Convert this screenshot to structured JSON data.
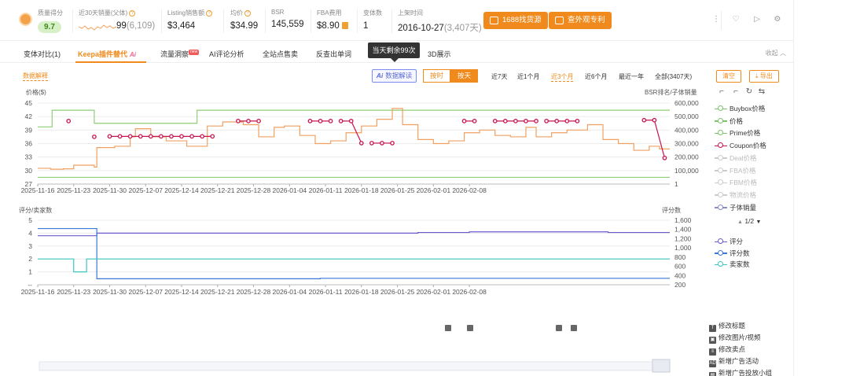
{
  "header": {
    "quality": {
      "label": "质量得分",
      "value": "9.7"
    },
    "sales30": {
      "label": "近30天销量(父体)",
      "value": "99",
      "paren": "(6,109)"
    },
    "listing_sales": {
      "label": "Listing销售额",
      "value": "$3,464"
    },
    "avg_price": {
      "label": "均价",
      "value": "$34.99"
    },
    "bsr": {
      "label": "BSR",
      "value": "145,559"
    },
    "fba": {
      "label": "FBA费用",
      "value": "$8.90"
    },
    "variants": {
      "label": "变体数",
      "value": "1"
    },
    "launch": {
      "label": "上架时间",
      "value": "2016-10-27",
      "paren": "(3,407天)"
    },
    "btn_source": "1688找货源",
    "btn_patent": "查外观专利"
  },
  "tooltip": "当天剩余99次",
  "tabs": [
    {
      "label": "变体对比(1)"
    },
    {
      "label": "Keepa插件替代",
      "ai": "Ai"
    },
    {
      "label": "流量洞察",
      "badge": "new"
    },
    {
      "label": "AI评论分析"
    },
    {
      "label": "全站点售卖"
    },
    {
      "label": "反查出单词"
    },
    {
      "label": "3D展示"
    }
  ],
  "collapse": "收起",
  "toolbar": {
    "data_explain": "数据解释",
    "ai_btn_ai": "Ai",
    "ai_btn_label": "数据解读",
    "seg_hour": "按时",
    "seg_day": "按天",
    "ranges": [
      "近7天",
      "近1个月",
      "近3个月",
      "近6个月",
      "最近一年",
      "全部(3407天)"
    ],
    "active_range": "近3个月",
    "clear": "清空",
    "export": "导出"
  },
  "legend": {
    "top": [
      {
        "label": "Buybox价格",
        "color": "#7cc46a",
        "off": false
      },
      {
        "label": "价格",
        "color": "#7cc46a",
        "off": false
      },
      {
        "label": "Prime价格",
        "color": "#7cc46a",
        "off": false
      },
      {
        "label": "Coupon价格",
        "color": "#c8144e",
        "off": false
      },
      {
        "label": "Deal价格",
        "color": "#ccc",
        "off": true
      },
      {
        "label": "FBA价格",
        "color": "#ccc",
        "off": true
      },
      {
        "label": "FBM价格",
        "color": "#ccc",
        "off": true
      },
      {
        "label": "物流价格",
        "color": "#ccc",
        "off": true
      },
      {
        "label": "子体销量",
        "color": "#8c8cc8",
        "off": false
      }
    ],
    "pager": "1/2",
    "bottom": [
      {
        "label": "评分",
        "color": "#6a5acd",
        "off": false
      },
      {
        "label": "评分数",
        "color": "#3a78d8",
        "off": false
      },
      {
        "label": "卖家数",
        "color": "#3cc8c0",
        "off": false
      }
    ]
  },
  "changes": [
    {
      "icon": "T",
      "label": "修改标题"
    },
    {
      "icon": "▣",
      "label": "修改图片/视频"
    },
    {
      "icon": "≡",
      "label": "修改卖点"
    },
    {
      "icon": "AD",
      "label": "新增广告活动"
    },
    {
      "icon": "▤",
      "label": "新增广告投放小组"
    }
  ],
  "chart_data": [
    {
      "type": "line",
      "ylabel": "价格($)",
      "y2label": "BSR排名/子体销量",
      "ylim": [
        27,
        45
      ],
      "yticks": [
        27,
        30,
        33,
        36,
        39,
        42,
        45
      ],
      "y2lim": [
        0,
        600000
      ],
      "y2ticks_labels": [
        "1",
        "100,000",
        "200,000",
        "300,000",
        "400,000",
        "500,000",
        "600,000"
      ],
      "xticks": [
        "2025-11-16",
        "2025-11-23",
        "2025-11-30",
        "2025-12-07",
        "2025-12-14",
        "2025-12-21",
        "2025-12-28",
        "2026-01-04",
        "2026-01-11",
        "2026-01-18",
        "2026-01-25",
        "2026-02-01",
        "2026-02-08"
      ],
      "grid": true,
      "series": [
        {
          "name": "价格",
          "color": "#8fce76",
          "step": true,
          "points": [
            [
              0,
              39.7
            ],
            [
              2.8,
              39.7
            ],
            [
              2.8,
              43.4
            ],
            [
              11,
              43.4
            ],
            [
              11,
              40.5
            ],
            [
              31,
              40.5
            ],
            [
              31,
              43.4
            ],
            [
              123,
              43.4
            ]
          ]
        },
        {
          "name": "Prime价格",
          "color": "#8fce76",
          "step": true,
          "points": [
            [
              0,
              28.5
            ],
            [
              123,
              28.5
            ]
          ]
        },
        {
          "name": "BSR",
          "color": "#f0a060",
          "step": true,
          "y2": true,
          "points": [
            [
              0,
              117000
            ],
            [
              2.5,
              110000
            ],
            [
              5,
              113000
            ],
            [
              7,
              140000
            ],
            [
              11,
              126000
            ],
            [
              11.5,
              270000
            ],
            [
              15,
              280000
            ],
            [
              18,
              350000
            ],
            [
              19,
              410000
            ],
            [
              22,
              350000
            ],
            [
              25,
              320000
            ],
            [
              29,
              280000
            ],
            [
              33,
              430000
            ],
            [
              36,
              460000
            ],
            [
              40,
              440000
            ],
            [
              43,
              350000
            ],
            [
              46,
              420000
            ],
            [
              48,
              430000
            ],
            [
              51,
              360000
            ],
            [
              54,
              300000
            ],
            [
              57,
              320000
            ],
            [
              60,
              380000
            ],
            [
              63,
              430000
            ],
            [
              66,
              480000
            ],
            [
              69,
              560000
            ],
            [
              71,
              440000
            ],
            [
              74,
              330000
            ],
            [
              77,
              300000
            ],
            [
              80,
              320000
            ],
            [
              83,
              380000
            ],
            [
              86,
              400000
            ],
            [
              89,
              360000
            ],
            [
              92,
              350000
            ],
            [
              95,
              420000
            ],
            [
              97,
              350000
            ],
            [
              100,
              380000
            ],
            [
              103,
              400000
            ],
            [
              107,
              440000
            ],
            [
              110,
              330000
            ],
            [
              113,
              300000
            ],
            [
              116,
              250000
            ],
            [
              119,
              280000
            ],
            [
              121,
              260000
            ],
            [
              123,
              260000
            ]
          ]
        },
        {
          "name": "Coupon价格",
          "color": "#c8144e",
          "markers": true,
          "segments": [
            [
              [
                6,
                41
              ]
            ],
            [
              [
                11,
                37.5
              ]
            ],
            [
              [
                14,
                37.6
              ],
              [
                16,
                37.6
              ],
              [
                18,
                37.6
              ],
              [
                20,
                37.6
              ],
              [
                22,
                37.6
              ],
              [
                24,
                37.6
              ],
              [
                26,
                37.6
              ],
              [
                28,
                37.6
              ],
              [
                30,
                37.6
              ],
              [
                32,
                37.6
              ],
              [
                34,
                37.6
              ]
            ],
            [
              [
                39,
                41
              ],
              [
                41,
                41
              ],
              [
                43,
                41
              ]
            ],
            [
              [
                53,
                41
              ],
              [
                55,
                41
              ],
              [
                57,
                41
              ]
            ],
            [
              [
                59,
                41
              ],
              [
                61,
                41
              ],
              [
                63,
                36.1
              ]
            ],
            [
              [
                65,
                36.1
              ],
              [
                67,
                36.1
              ],
              [
                69,
                36.1
              ]
            ],
            [
              [
                83,
                41
              ],
              [
                85,
                41
              ]
            ],
            [
              [
                89,
                41
              ],
              [
                91,
                41
              ],
              [
                93,
                41
              ],
              [
                95,
                41
              ],
              [
                97,
                41
              ]
            ],
            [
              [
                99,
                41
              ],
              [
                101,
                41
              ],
              [
                103,
                41
              ],
              [
                105,
                41
              ]
            ],
            [
              [
                118,
                41.2
              ],
              [
                120,
                41.2
              ],
              [
                122,
                32.8
              ]
            ]
          ]
        }
      ]
    },
    {
      "type": "line",
      "ylabel": "评分/卖家数",
      "y2label": "评分数",
      "ylim": [
        0,
        5
      ],
      "yticks_labels": [
        "--",
        "1",
        "2",
        "3",
        "4",
        "5"
      ],
      "y2lim": [
        200,
        1600
      ],
      "y2ticks": [
        200,
        400,
        600,
        800,
        1000,
        1200,
        1400,
        1600
      ],
      "xticks": [
        "2025-11-16",
        "2025-11-23",
        "2025-11-30",
        "2025-12-07",
        "2025-12-14",
        "2025-12-21",
        "2025-12-28",
        "2026-01-04",
        "2026-01-11",
        "2026-01-18",
        "2026-01-25",
        "2026-02-01",
        "2026-02-08"
      ],
      "grid": true,
      "series": [
        {
          "name": "评分",
          "color": "#6a5acd",
          "step": true,
          "points": [
            [
              0,
              3.8
            ],
            [
              11.5,
              3.8
            ],
            [
              11.5,
              4.0
            ],
            [
              74,
              4.0
            ],
            [
              74,
              4.05
            ],
            [
              84,
              4.05
            ],
            [
              84,
              4.1
            ],
            [
              111,
              4.1
            ],
            [
              111,
              4.05
            ],
            [
              123,
              4.05
            ]
          ]
        },
        {
          "name": "评分数",
          "color": "#3a78d8",
          "step": true,
          "y2": true,
          "points": [
            [
              0,
              1420
            ],
            [
              11.5,
              1420
            ],
            [
              11.5,
              330
            ],
            [
              55,
              330
            ],
            [
              55,
              340
            ],
            [
              123,
              340
            ]
          ]
        },
        {
          "name": "卖家数",
          "color": "#3cc8c0",
          "step": true,
          "points": [
            [
              0,
              2
            ],
            [
              7,
              2
            ],
            [
              7,
              1
            ],
            [
              9.5,
              1
            ],
            [
              9.5,
              2
            ],
            [
              123,
              2
            ]
          ]
        }
      ]
    }
  ]
}
